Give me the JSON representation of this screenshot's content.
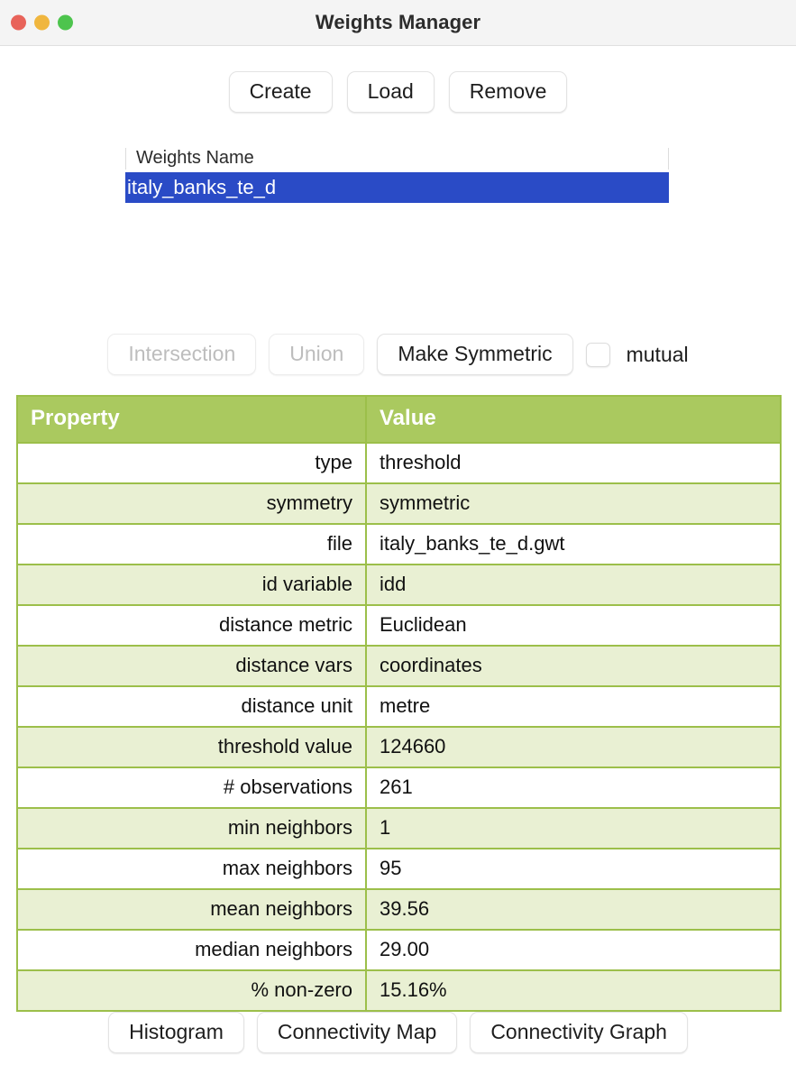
{
  "window": {
    "title": "Weights Manager",
    "controls": [
      {
        "name": "close",
        "color": "#e8635a"
      },
      {
        "name": "minimize",
        "color": "#f0b63e"
      },
      {
        "name": "maximize",
        "color": "#4dc44d"
      }
    ]
  },
  "toolbar": {
    "create_label": "Create",
    "load_label": "Load",
    "remove_label": "Remove"
  },
  "weights_list": {
    "column_header": "Weights Name",
    "rows": [
      {
        "name": "italy_banks_te_d",
        "selected": true
      }
    ],
    "selection_color": "#2a4bc6"
  },
  "set_ops": {
    "intersection_label": "Intersection",
    "intersection_enabled": false,
    "union_label": "Union",
    "union_enabled": false,
    "make_symmetric_label": "Make Symmetric",
    "make_symmetric_enabled": true,
    "mutual_label": "mutual",
    "mutual_checked": false
  },
  "properties_table": {
    "header_color": "#aac95f",
    "columns": [
      "Property",
      "Value"
    ],
    "rows": [
      {
        "property": "type",
        "value": "threshold"
      },
      {
        "property": "symmetry",
        "value": "symmetric"
      },
      {
        "property": "file",
        "value": "italy_banks_te_d.gwt"
      },
      {
        "property": "id variable",
        "value": "idd"
      },
      {
        "property": "distance metric",
        "value": "Euclidean"
      },
      {
        "property": "distance vars",
        "value": "coordinates"
      },
      {
        "property": "distance unit",
        "value": "metre"
      },
      {
        "property": "threshold value",
        "value": "124660"
      },
      {
        "property": "# observations",
        "value": "261"
      },
      {
        "property": "min neighbors",
        "value": "1"
      },
      {
        "property": "max neighbors",
        "value": "95"
      },
      {
        "property": "mean neighbors",
        "value": "39.56"
      },
      {
        "property": "median neighbors",
        "value": "29.00"
      },
      {
        "property": "% non-zero",
        "value": "15.16%"
      }
    ]
  },
  "footer": {
    "histogram_label": "Histogram",
    "connectivity_map_label": "Connectivity Map",
    "connectivity_graph_label": "Connectivity Graph"
  }
}
